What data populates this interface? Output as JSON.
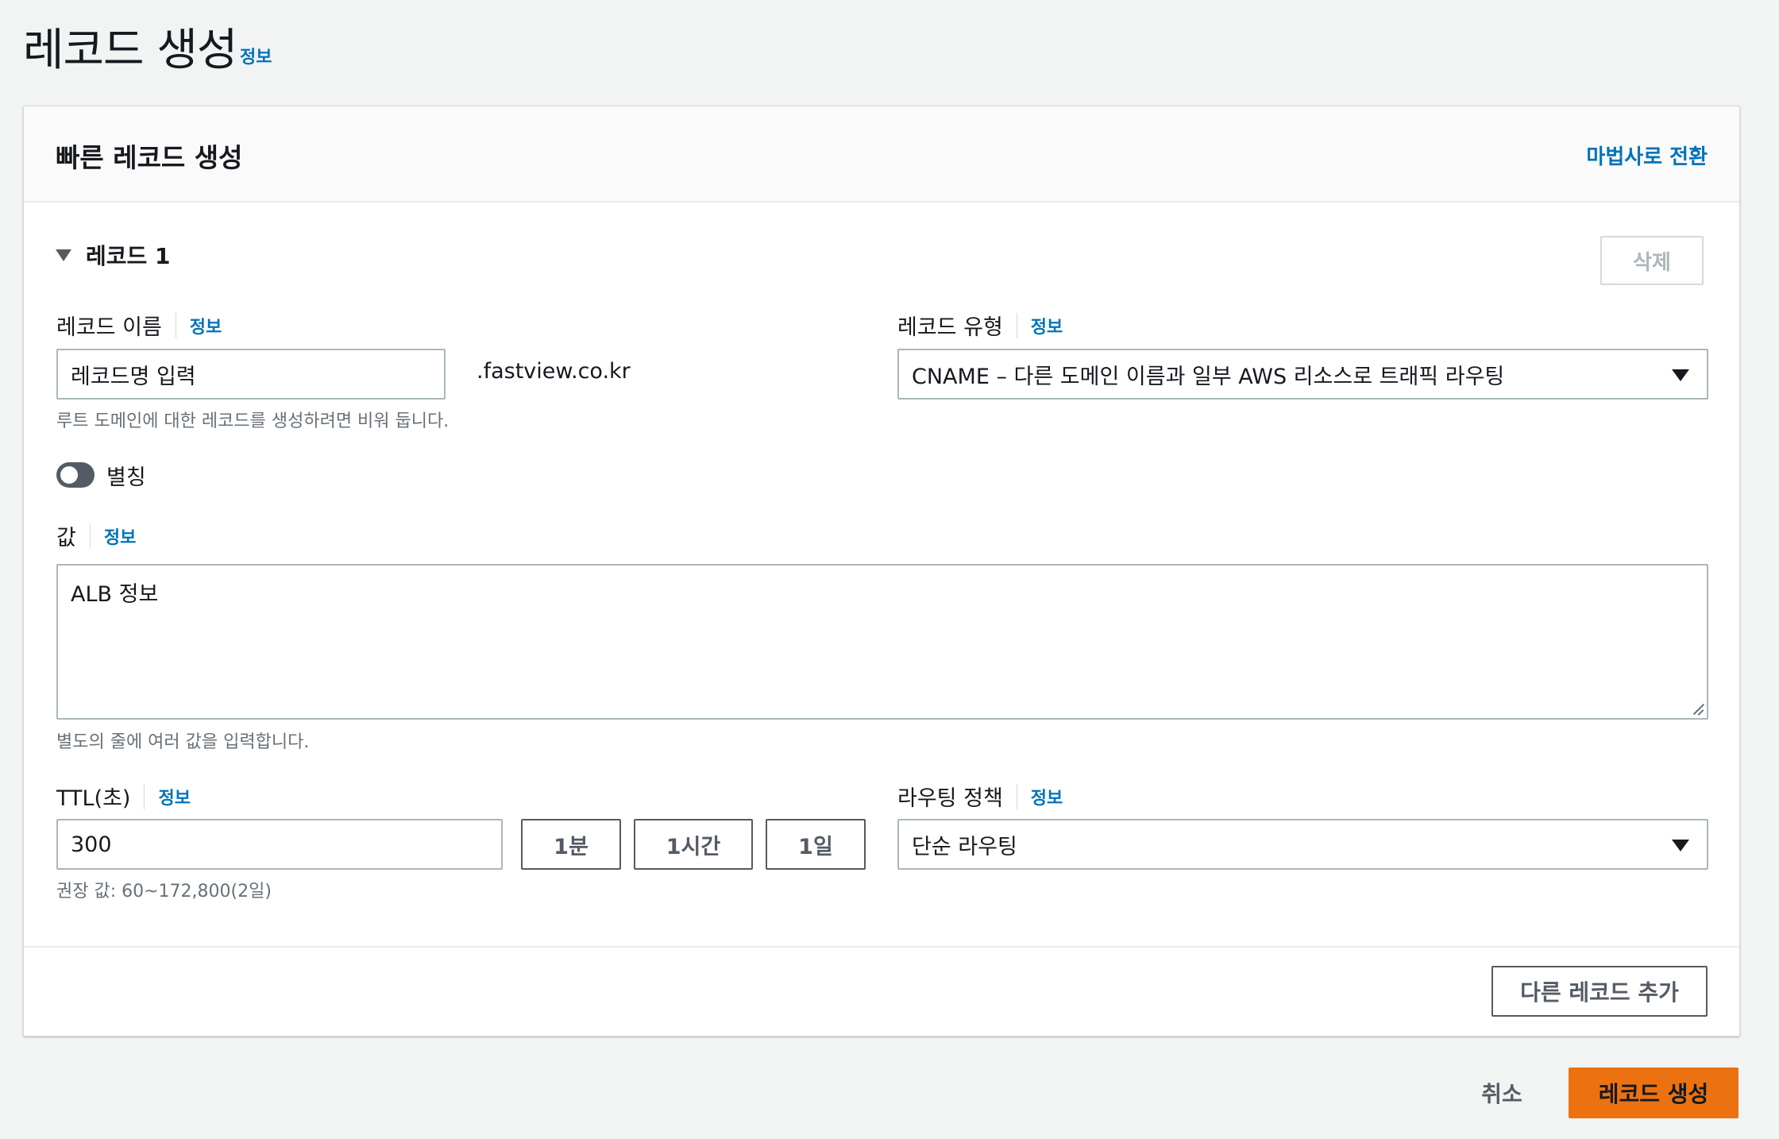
{
  "page": {
    "title": "레코드 생성",
    "info": "정보"
  },
  "card": {
    "title": "빠른 레코드 생성",
    "wizard_link": "마법사로 전환"
  },
  "record": {
    "header": "레코드 1",
    "delete_label": "삭제",
    "name": {
      "label": "레코드 이름",
      "info": "정보",
      "placeholder": "레코드명 입력",
      "domain_suffix": ".fastview.co.kr",
      "hint": "루트 도메인에 대한 레코드를 생성하려면 비워 둡니다."
    },
    "type": {
      "label": "레코드 유형",
      "info": "정보",
      "value": "CNAME – 다른 도메인 이름과 일부 AWS 리소스로 트래픽 라우팅"
    },
    "alias": {
      "label": "별칭",
      "enabled": false
    },
    "value": {
      "label": "값",
      "info": "정보",
      "text": "ALB 정보",
      "hint": "별도의 줄에 여러 값을 입력합니다."
    },
    "ttl": {
      "label": "TTL(초)",
      "info": "정보",
      "value": "300",
      "presets": [
        "1분",
        "1시간",
        "1일"
      ],
      "hint": "권장 값: 60~172,800(2일)"
    },
    "routing": {
      "label": "라우팅 정책",
      "info": "정보",
      "value": "단순 라우팅"
    }
  },
  "footer": {
    "add_record": "다른 레코드 추가",
    "cancel": "취소",
    "create": "레코드 생성"
  },
  "colors": {
    "primary": "#ec7211",
    "link": "#0073bb",
    "background": "#f2f3f3"
  }
}
